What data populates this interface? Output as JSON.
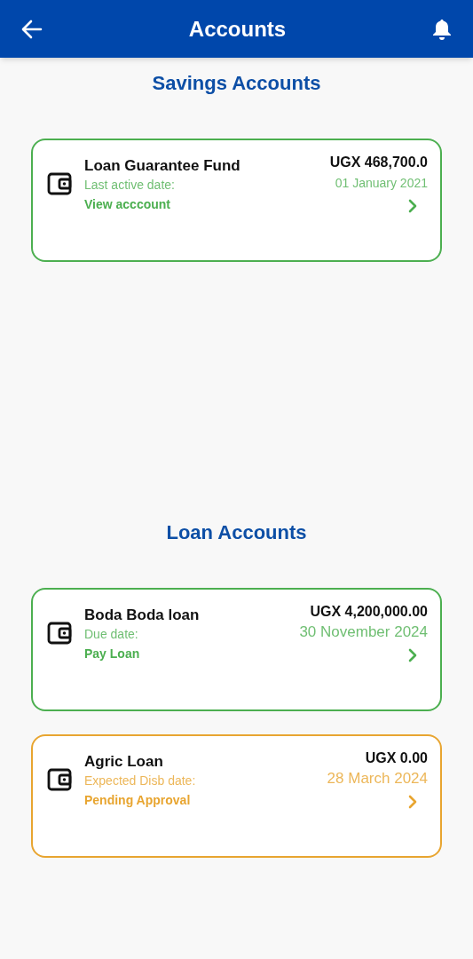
{
  "app_bar": {
    "title": "Accounts"
  },
  "sections": [
    {
      "heading": "Savings Accounts",
      "accounts": [
        {
          "name": "Loan Guarantee Fund",
          "date_label": "Last active date:",
          "action": "View acccount",
          "amount": "UGX 468,700.0",
          "date": "01 January 2021",
          "color": "#4caf50"
        }
      ]
    },
    {
      "heading": "Loan Accounts",
      "accounts": [
        {
          "name": "Boda Boda loan",
          "date_label": "Due date:",
          "action": "Pay Loan",
          "amount": "UGX 4,200,000.00",
          "date": "30 November 2024",
          "color": "#4caf50"
        },
        {
          "name": "Agric Loan",
          "date_label": "Expected Disb date:",
          "action": "Pending Approval",
          "amount": "UGX 0.00",
          "date": "28 March 2024",
          "color": "#e8a530"
        }
      ]
    }
  ]
}
